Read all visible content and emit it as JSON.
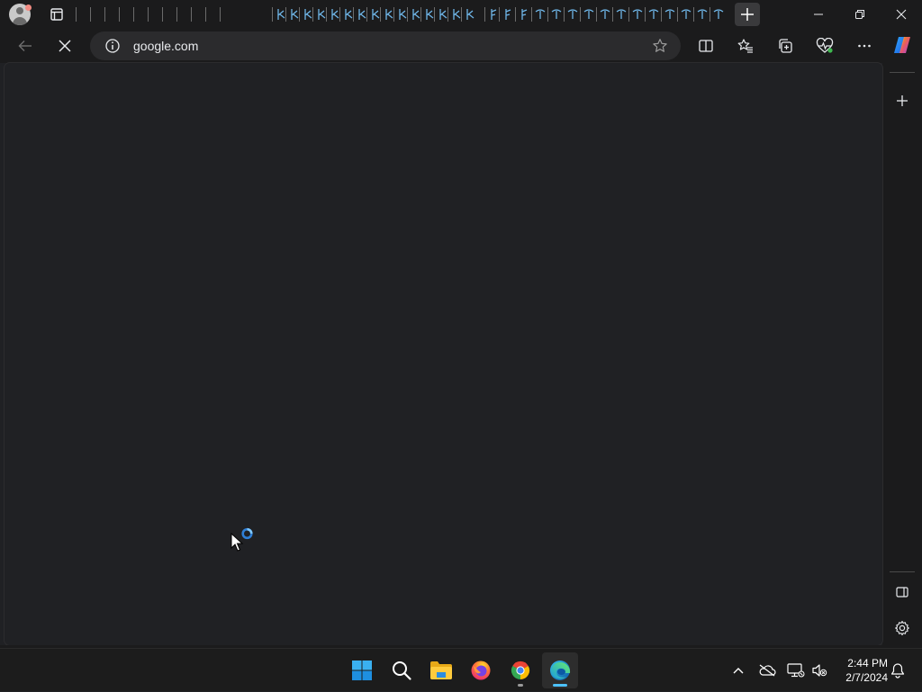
{
  "browser": {
    "address": "google.com"
  },
  "taskbar": {
    "time": "2:44 PM",
    "date": "2/7/2024"
  },
  "colors": {
    "accent": "#4cc2ff",
    "chrome_bg": "#1b1b1c",
    "content_bg": "#202124"
  }
}
